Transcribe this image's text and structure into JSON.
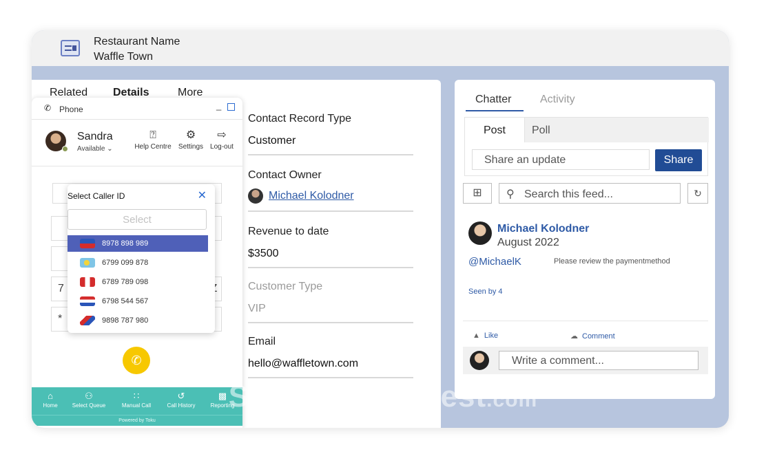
{
  "header": {
    "restaurant_label": "Restaurant Name",
    "restaurant_value": "Waffle Town",
    "icon": "record-card-icon"
  },
  "details_tabs": [
    "Related",
    "Details",
    "More"
  ],
  "fields": [
    {
      "label": "Contact Record Type",
      "value": "Customer"
    },
    {
      "label": "Contact Owner",
      "value": "Michael Kolodner"
    },
    {
      "label": "Revenue to date",
      "value": "$3500"
    },
    {
      "label": "Customer Type",
      "value": "VIP"
    },
    {
      "label": "Email",
      "value": "hello@waffletown.com"
    }
  ],
  "phone": {
    "title": "Phone",
    "minimize": "_",
    "agent": {
      "name": "Sandra",
      "status": "Available"
    },
    "tools": [
      {
        "label": "Help Centre",
        "icon": "help-icon"
      },
      {
        "label": "Settings",
        "icon": "gear-icon"
      },
      {
        "label": "Log-out",
        "icon": "logout-icon"
      }
    ],
    "keypad_fragments": [
      "7",
      "*",
      "YZ"
    ],
    "caller_id": {
      "title": "Select Caller ID",
      "placeholder": "Select",
      "options": [
        {
          "number": "8978 898 989",
          "flag": "philippines-flag"
        },
        {
          "number": "6799 099 878",
          "flag": "palau-flag"
        },
        {
          "number": "6789 789 098",
          "flag": "peru-flag"
        },
        {
          "number": "6798 544 567",
          "flag": "paraguay-flag"
        },
        {
          "number": "9898 787 980",
          "flag": "panama-flag"
        }
      ]
    },
    "nav": [
      {
        "label": "Home",
        "icon": "home-icon"
      },
      {
        "label": "Select Queue",
        "icon": "queue-icon"
      },
      {
        "label": "Manual Call",
        "icon": "dialpad-icon"
      },
      {
        "label": "Call History",
        "icon": "history-icon"
      },
      {
        "label": "Reporting",
        "icon": "bar-chart-icon"
      }
    ],
    "powered_by": "Powered by Toku"
  },
  "chatter": {
    "tabs": [
      "Chatter",
      "Activity"
    ],
    "composer_tabs": [
      "Post",
      "Poll"
    ],
    "share_placeholder": "Share an update",
    "share_button": "Share",
    "search_placeholder": "Search this feed...",
    "post": {
      "author": "Michael Kolodner",
      "date": "August 2022",
      "mention": "@MichaelK",
      "body": "Please review the paymentmethod",
      "seen": "Seen by 4"
    },
    "actions": [
      "Like",
      "Comment"
    ],
    "comment_placeholder": "Write a comment..."
  },
  "watermark": {
    "main": "SoftwareSuggest",
    "suffix": ".com"
  },
  "colors": {
    "accent": "#2e5aa6",
    "share": "#214c95",
    "teal": "#4bbfb5",
    "call": "#f7c800",
    "selected": "#4f60b8"
  }
}
